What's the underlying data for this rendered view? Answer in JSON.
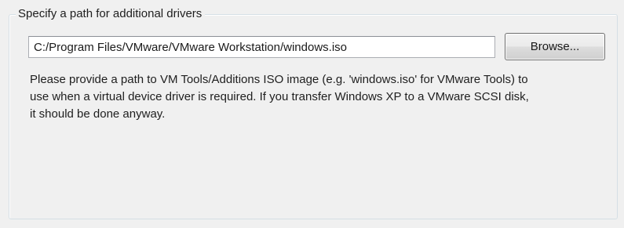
{
  "group": {
    "title": "Specify a path for additional drivers"
  },
  "path_field": {
    "value": "C:/Program Files/VMware/VMware Workstation/windows.iso"
  },
  "browse_button": {
    "label": "Browse..."
  },
  "description": {
    "lines": [
      "Please provide a path to VM Tools/Additions ISO image (e.g. 'windows.iso' for VMware Tools) to",
      "use when a virtual device driver is required. If you transfer Windows XP to a VMware SCSI disk,",
      "it should be done anyway."
    ]
  }
}
